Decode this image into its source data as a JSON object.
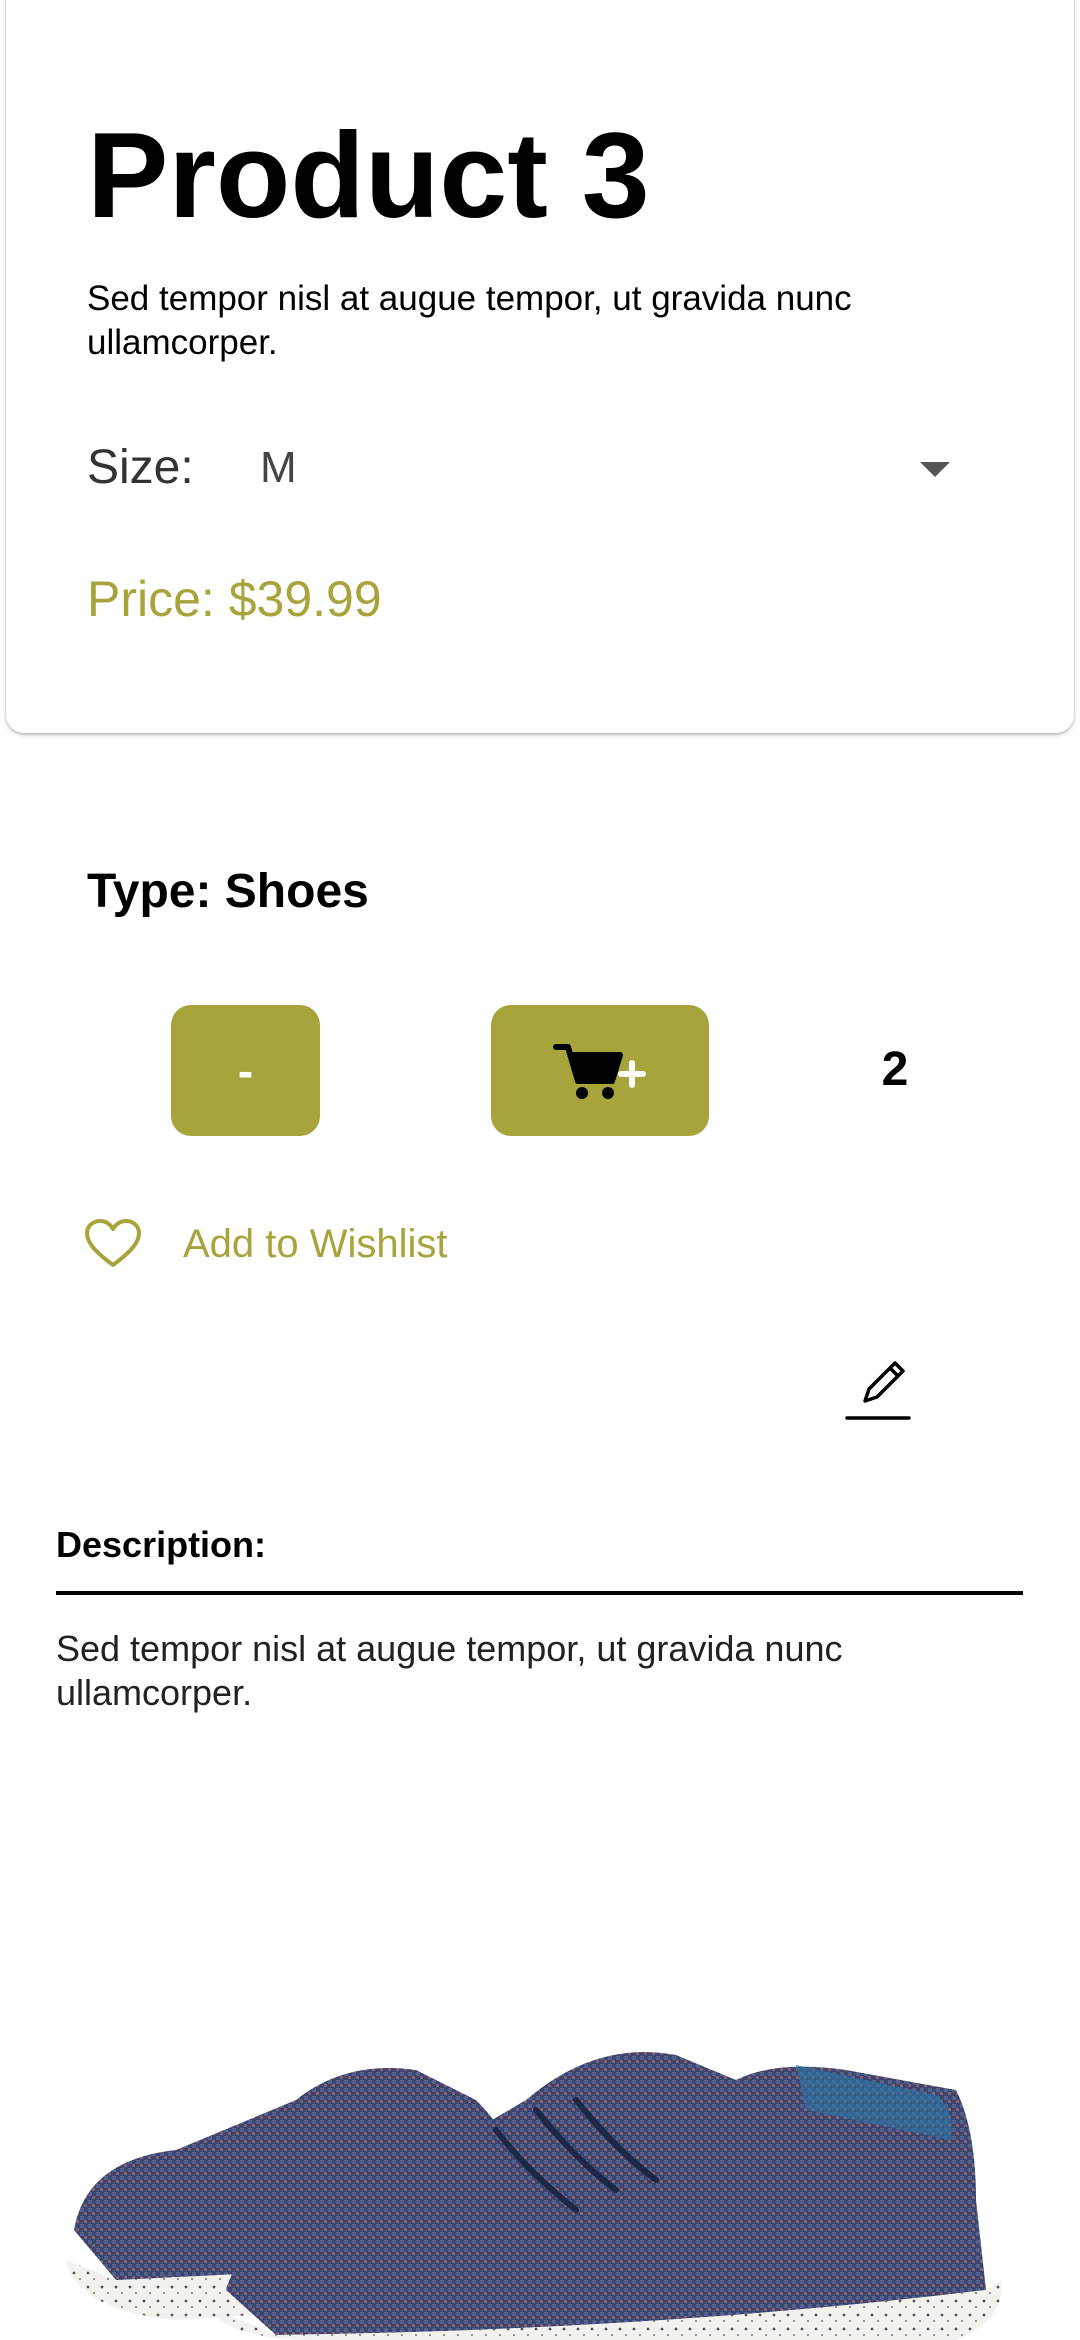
{
  "product": {
    "title": "Product 3",
    "subtitle": "Sed tempor nisl at augue tempor, ut gravida nunc ullamcorper.",
    "size_label": "Size:",
    "size_value": "M",
    "price": "Price: $39.99",
    "type": "Type: Shoes"
  },
  "cart": {
    "minus_label": "-",
    "add_icon": "cart-plus-icon",
    "quantity": "2"
  },
  "wishlist": {
    "label": "Add to Wishlist",
    "icon": "heart-outline-icon"
  },
  "edit": {
    "icon": "pencil-edit-icon"
  },
  "description": {
    "label": "Description:",
    "text": "Sed tempor nisl at augue tempor, ut gravida nunc ullamcorper."
  },
  "colors": {
    "accent": "#a8a43c",
    "text": "#000000"
  }
}
